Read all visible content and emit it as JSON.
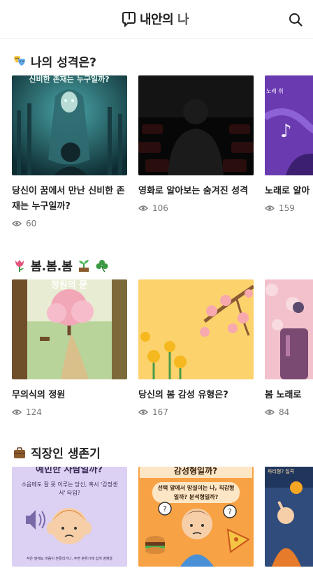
{
  "app": {
    "logo_main": "내안의",
    "logo_sub": "나"
  },
  "sections": [
    {
      "title": "나의 성격은?",
      "emoji": "theater-masks",
      "cards": [
        {
          "title": "당신이 꿈에서 만난 신비한 존재는 누구일까?",
          "views": "60",
          "thumb_text": "신비한 존재는 누구일까?"
        },
        {
          "title": "영화로 알아보는 숨겨진 성격",
          "views": "106"
        },
        {
          "title": "노래로 알아",
          "views": "159",
          "thumb_text": "노래 취"
        }
      ]
    },
    {
      "title": "봄.봄.봄",
      "emoji_left": "tulip",
      "emoji_right": "seedling-clover",
      "cards": [
        {
          "title": "무의식의 정원",
          "views": "124",
          "thumb_text": "정원의 문"
        },
        {
          "title": "당신의 봄 감성 유형은?",
          "views": "167"
        },
        {
          "title": "봄 노래로",
          "views": "84"
        }
      ]
    },
    {
      "title": "직장인 생존기",
      "emoji": "briefcase",
      "cards": [
        {
          "thumb_text": "예민한 사람일까?",
          "thumb_sub": "소음에도 잘 못 이루는 당신, 혹시 '감정센서' 타입?",
          "thumb_foot": "작은 말에도 마음이 흔들리거나, 주변 분위기에 쉽게 영향을"
        },
        {
          "thumb_text": "감성형일까?",
          "thumb_sub": "선택 앞에서 망설이는 나, 직감형일까? 분석형일까?"
        },
        {
          "thumb_text": "파티형? 집콕"
        }
      ]
    }
  ],
  "colors": {
    "accent": "#222222",
    "muted": "#777777",
    "divider": "#eeeeee"
  }
}
